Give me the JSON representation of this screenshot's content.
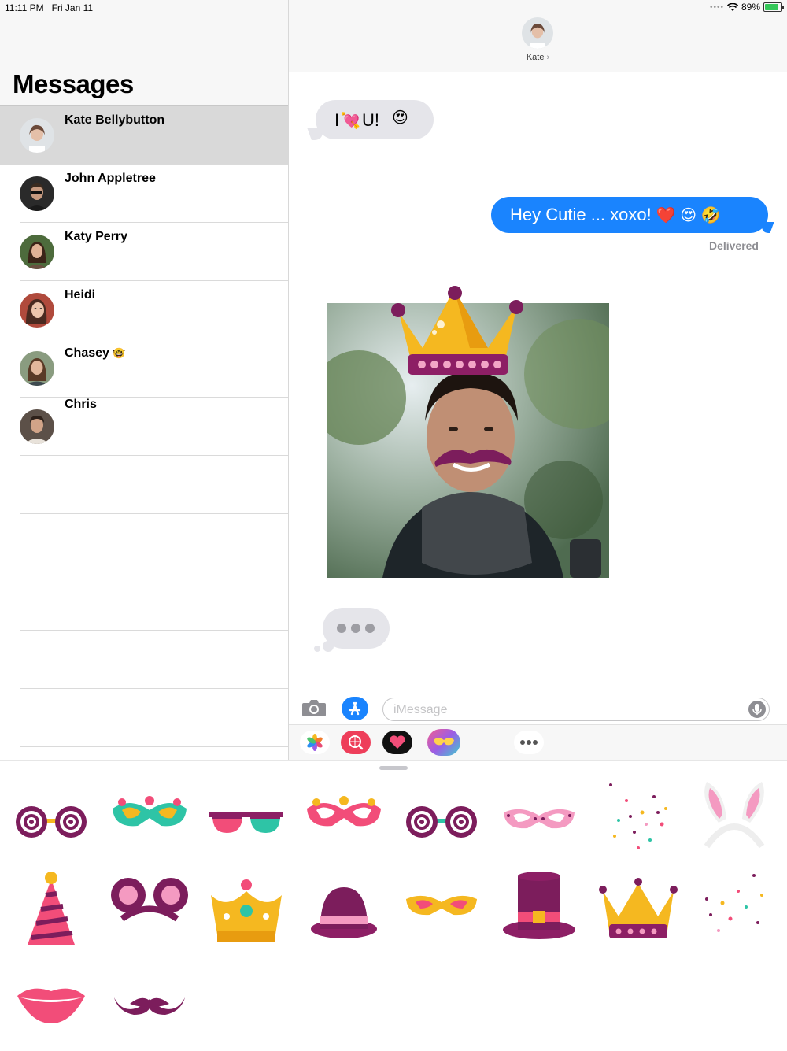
{
  "status_bar": {
    "time": "11:11 PM",
    "date": "Fri Jan 11",
    "battery_pct": "89%",
    "battery_level": 0.89
  },
  "sidebar": {
    "title": "Messages",
    "conversations": [
      {
        "name": "Kate Bellybutton",
        "selected": true
      },
      {
        "name": "John Appletree",
        "selected": false
      },
      {
        "name": "Katy Perry",
        "selected": false
      },
      {
        "name": "Heidi",
        "selected": false
      },
      {
        "name": "Chasey",
        "emoji": "🤓",
        "selected": false
      },
      {
        "name": "Chris",
        "selected": false
      }
    ]
  },
  "chat": {
    "contact": "Kate",
    "messages": {
      "incoming_text": "I",
      "incoming_text2": "U!",
      "incoming_emoji1": "💘",
      "incoming_emoji2": "😍",
      "outgoing_text": "Hey Cutie ... xoxo!",
      "outgoing_emojis": "❤️ 😍 🤣",
      "status": "Delivered"
    }
  },
  "input": {
    "placeholder": "iMessage"
  },
  "stickers": [
    "spiral-glasses",
    "carnival-mask-green",
    "pink-sunglasses",
    "carnival-mask-pink",
    "spiral-glasses-teal",
    "sparkle-mask",
    "confetti",
    "bunny-ears",
    "party-hat",
    "mouse-ears",
    "gold-crown-jewel",
    "bowler-hat",
    "yellow-mask",
    "top-hat",
    "gold-crown",
    "confetti-small",
    "lips",
    "mustache"
  ],
  "colors": {
    "accent": "#1a84fe",
    "incoming_bubble": "#e5e5ea",
    "selected_row": "#d9d9d9"
  }
}
